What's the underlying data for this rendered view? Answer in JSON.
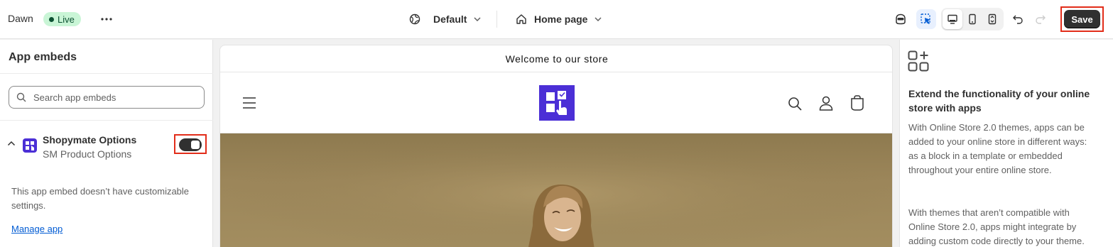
{
  "topbar": {
    "theme_name": "Dawn",
    "live_label": "Live",
    "more_icon": "ellipsis-icon",
    "selector_default": "Default",
    "selector_page": "Home page",
    "save_label": "Save"
  },
  "sidebar": {
    "title": "App embeds",
    "search_placeholder": "Search app embeds",
    "embed": {
      "app_name": "Shopymate Options",
      "app_sub": "SM Product Options",
      "enabled": true
    },
    "note": "This app embed doesn’t have customizable settings.",
    "manage_link": "Manage app"
  },
  "preview": {
    "announcement": "Welcome to our store"
  },
  "right_panel": {
    "title": "Extend the functionality of your online store with apps",
    "body1": "With Online Store 2.0 themes, apps can be added to your online store in different ways: as a block in a template or embedded throughout your entire online store.",
    "body2": "With themes that aren’t compatible with Online Store 2.0, apps might integrate by adding custom code directly to your theme."
  },
  "colors": {
    "accent": "#4b2fd6",
    "save_bg": "#303030",
    "highlight": "#e22d1a",
    "link": "#005bd3",
    "live_badge": "#c9f5d6"
  }
}
